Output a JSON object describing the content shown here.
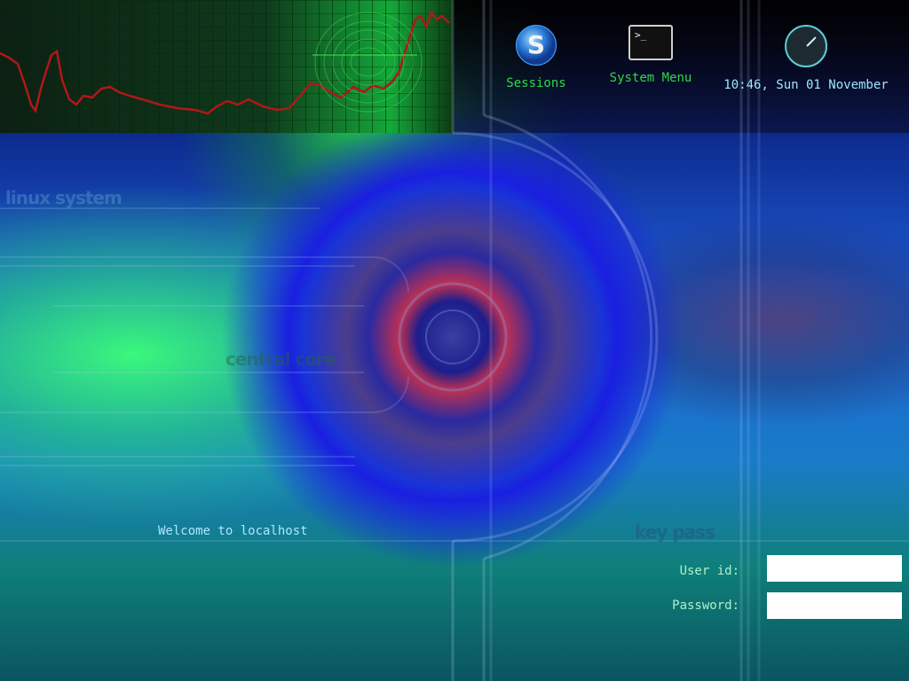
{
  "background_labels": {
    "linux_system": "linux system",
    "central_core": "central core",
    "key_pass": "key pass"
  },
  "top_bar": {
    "sessions": {
      "label": "Sessions",
      "icon": "sessions-icon"
    },
    "system_menu": {
      "label": "System Menu",
      "icon": "terminal-icon"
    },
    "clock": {
      "label": "10:46, Sun 01 November",
      "icon": "clock-icon"
    }
  },
  "welcome": "Welcome to localhost",
  "login": {
    "user_label": "User id:",
    "user_value": "",
    "password_label": "Password:",
    "password_value": ""
  },
  "colors": {
    "accent_green": "#2fd84a",
    "text_cyan": "#aee6ff"
  }
}
